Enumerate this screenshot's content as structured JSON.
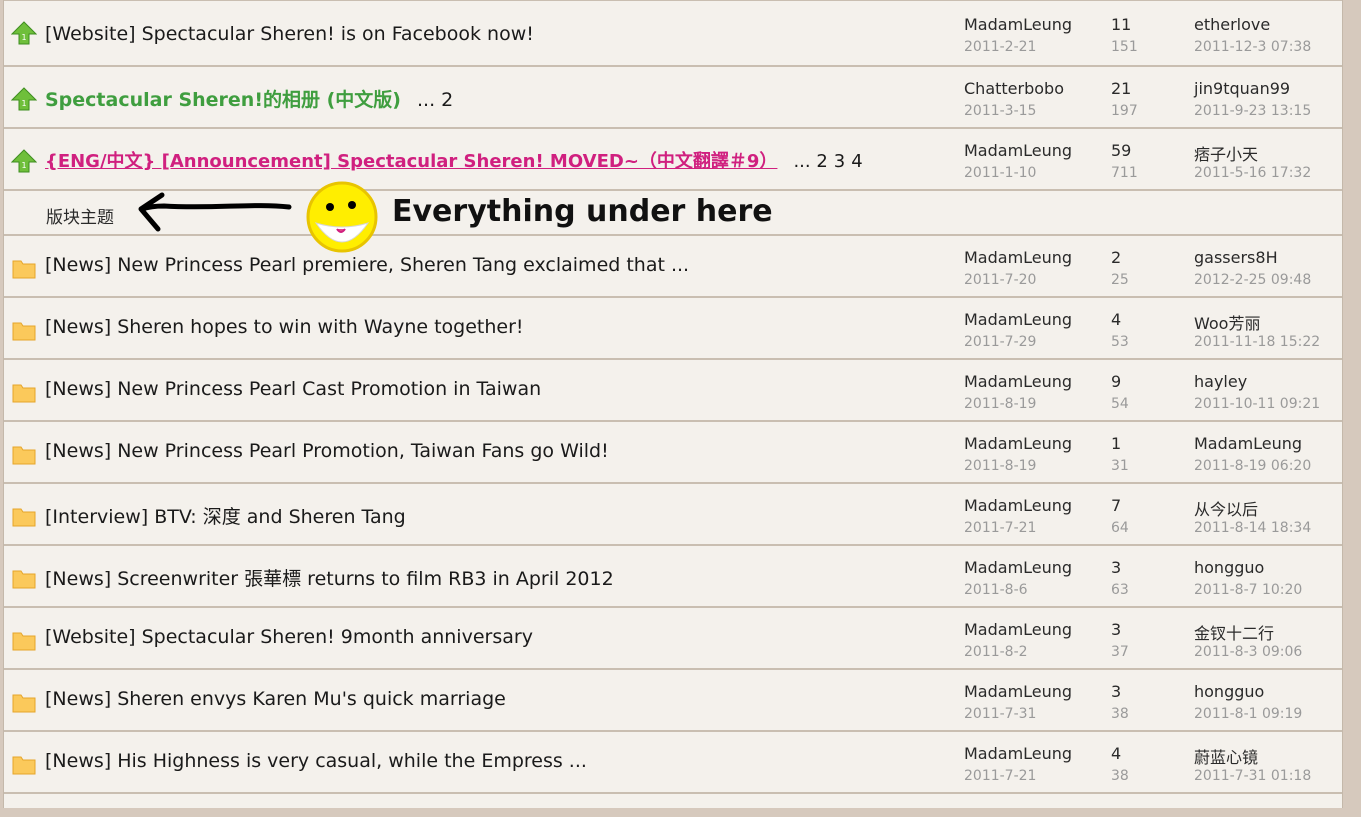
{
  "colors": {
    "background": "#f4f1ec",
    "border": "#c9beb1",
    "sticky_green": "#3f9e3f",
    "pink_link": "#d0207f",
    "muted": "#9a9a9a",
    "folder_yellow": "#fbc95b",
    "smiley_yellow": "#ffee00"
  },
  "sticky_topics": [
    {
      "icon": "green-up-arrow-icon",
      "title": "[Website] Spectacular Sheren! is on Facebook now!",
      "style": "normal",
      "pages": [],
      "author": "MadamLeung",
      "date": "2011-2-21",
      "replies": "11",
      "views": "151",
      "last_user": "etherlove",
      "last_time": "2011-12-3 07:38"
    },
    {
      "icon": "green-up-arrow-icon",
      "title": "Spectacular Sheren!的相册 (中文版)",
      "style": "green",
      "pages": [
        "... 2"
      ],
      "author": "Chatterbobo",
      "date": "2011-3-15",
      "replies": "21",
      "views": "197",
      "last_user": "jin9tquan99",
      "last_time": "2011-9-23 13:15"
    },
    {
      "icon": "green-up-arrow-icon",
      "title": "{ENG/中文} [Announcement] Spectacular Sheren! MOVED~（中文翻譯＃9）",
      "style": "pink",
      "pages": [
        "... 2",
        "3",
        "4"
      ],
      "author": "MadamLeung",
      "date": "2011-1-10",
      "replies": "59",
      "views": "711",
      "last_user": "痞子小天",
      "last_time": "2011-5-16 17:32"
    }
  ],
  "separator": {
    "label": "版块主题",
    "annotation": "Everything under here"
  },
  "topics": [
    {
      "title": "[News] New Princess Pearl premiere, Sheren Tang exclaimed that ...",
      "author": "MadamLeung",
      "date": "2011-7-20",
      "replies": "2",
      "views": "25",
      "last_user": "gassers8H",
      "last_time": "2012-2-25 09:48"
    },
    {
      "title": "[News] Sheren hopes to win with Wayne together!",
      "author": "MadamLeung",
      "date": "2011-7-29",
      "replies": "4",
      "views": "53",
      "last_user": "Woo芳丽",
      "last_time": "2011-11-18 15:22"
    },
    {
      "title": "[News] New Princess Pearl Cast Promotion in Taiwan",
      "author": "MadamLeung",
      "date": "2011-8-19",
      "replies": "9",
      "views": "54",
      "last_user": "hayley",
      "last_time": "2011-10-11 09:21"
    },
    {
      "title": "[News] New Princess Pearl Promotion, Taiwan Fans go Wild!",
      "author": "MadamLeung",
      "date": "2011-8-19",
      "replies": "1",
      "views": "31",
      "last_user": "MadamLeung",
      "last_time": "2011-8-19 06:20"
    },
    {
      "title": "[Interview] BTV: 深度 and Sheren Tang",
      "author": "MadamLeung",
      "date": "2011-7-21",
      "replies": "7",
      "views": "64",
      "last_user": "从今以后",
      "last_time": "2011-8-14 18:34"
    },
    {
      "title": "[News] Screenwriter 張華標 returns to film RB3 in April 2012",
      "author": "MadamLeung",
      "date": "2011-8-6",
      "replies": "3",
      "views": "63",
      "last_user": "hongguo",
      "last_time": "2011-8-7 10:20"
    },
    {
      "title": "[Website] Spectacular Sheren! 9month anniversary",
      "author": "MadamLeung",
      "date": "2011-8-2",
      "replies": "3",
      "views": "37",
      "last_user": "金钗十二行",
      "last_time": "2011-8-3 09:06"
    },
    {
      "title": "[News] Sheren envys Karen Mu's quick marriage",
      "author": "MadamLeung",
      "date": "2011-7-31",
      "replies": "3",
      "views": "38",
      "last_user": "hongguo",
      "last_time": "2011-8-1 09:19"
    },
    {
      "title": "[News] His Highness is very casual, while the Empress ...",
      "author": "MadamLeung",
      "date": "2011-7-21",
      "replies": "4",
      "views": "38",
      "last_user": "蔚蓝心镜",
      "last_time": "2011-7-31 01:18"
    }
  ]
}
